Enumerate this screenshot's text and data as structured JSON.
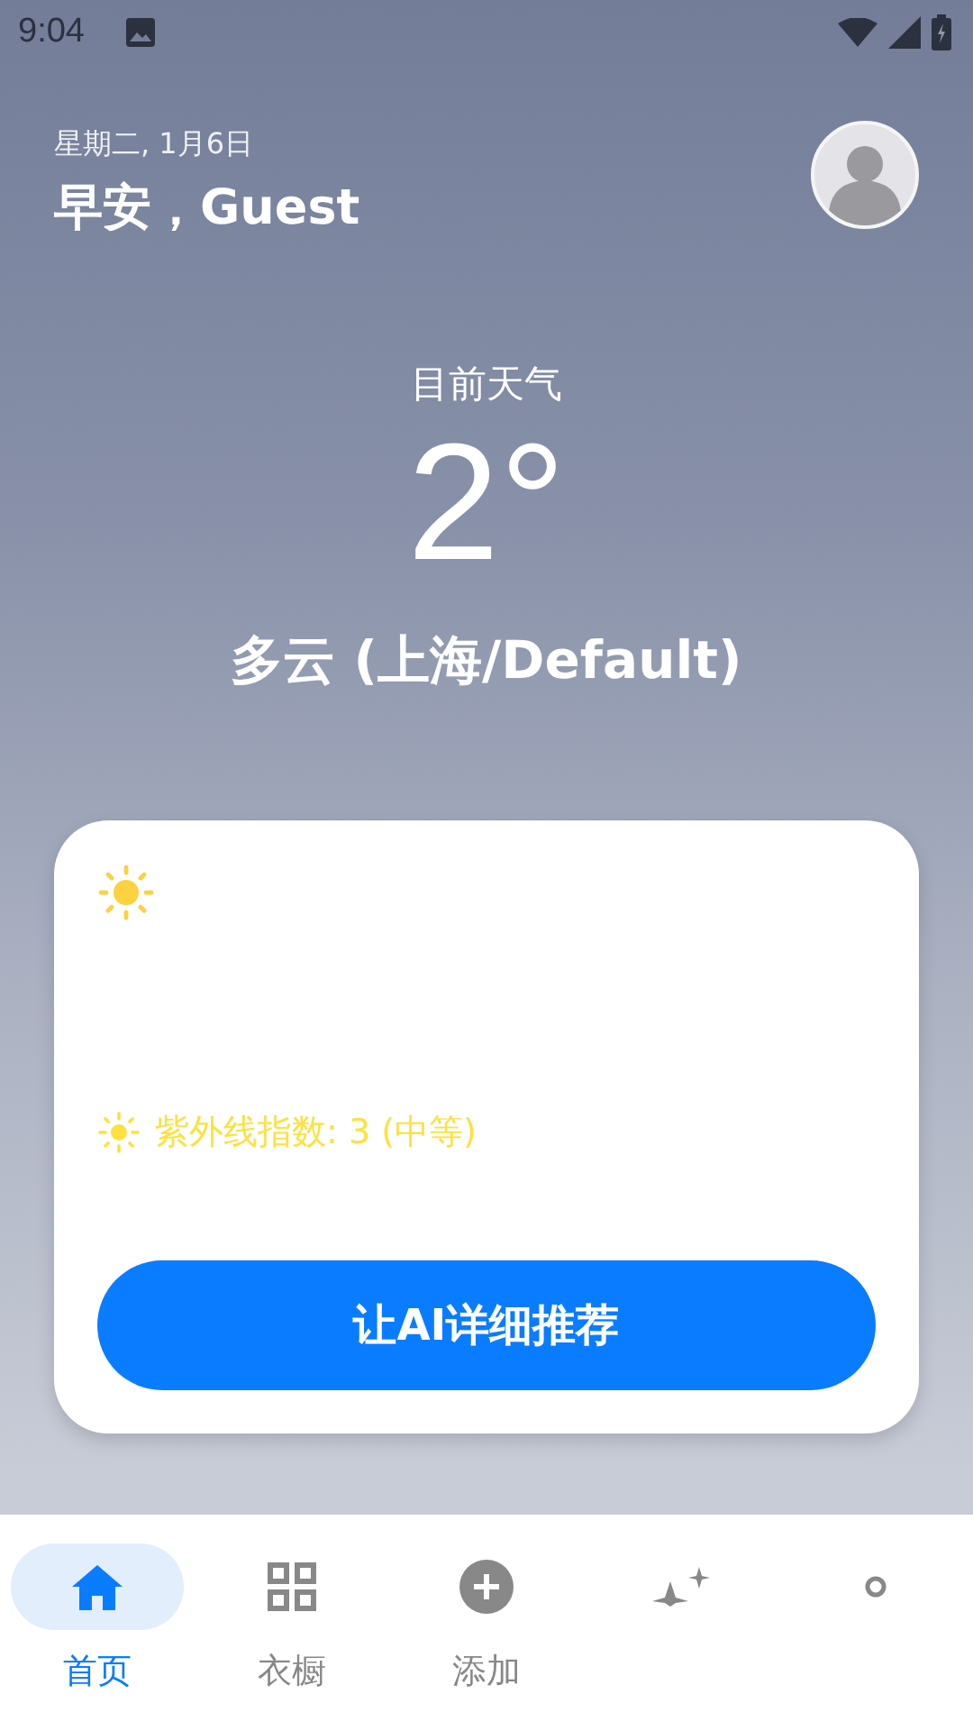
{
  "status_bar": {
    "time": "9:04"
  },
  "header": {
    "date": "星期二, 1月6日",
    "greeting": "早安，Guest"
  },
  "weather": {
    "caption": "目前天气",
    "temperature": "2°",
    "condition": "多云 (上海/Default)"
  },
  "card": {
    "uv_index": "紫外线指数: 3 (中等)",
    "button": "让AI详细推荐"
  },
  "nav": [
    {
      "kind": "home",
      "label": "首页",
      "selected": true
    },
    {
      "kind": "wardrobe",
      "label": "衣橱",
      "selected": false
    },
    {
      "kind": "add",
      "label": "添加",
      "selected": false
    },
    {
      "kind": "sparkle",
      "selected": false
    },
    {
      "kind": "dot",
      "selected": false
    }
  ]
}
